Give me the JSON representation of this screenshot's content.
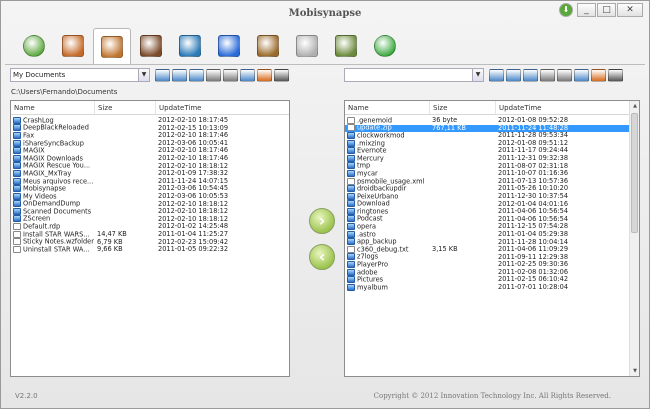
{
  "app": {
    "title": "Mobisynapse",
    "version": "V2.2.0",
    "copyright": "Copyright © 2012 Innovation Technology Inc. All Rights Reserved."
  },
  "window": {
    "update_icon": "update-icon",
    "minimize": "_",
    "maximize": "□",
    "close": "✕"
  },
  "tabs": [
    {
      "name": "home-icon",
      "color": "#5aa83c"
    },
    {
      "name": "device-icon",
      "color": "#c46a2a"
    },
    {
      "name": "file-manager-icon",
      "color": "#c0742e"
    },
    {
      "name": "photo-icon",
      "color": "#7a4a2a"
    },
    {
      "name": "video-icon",
      "color": "#2a7ab8"
    },
    {
      "name": "music-icon",
      "color": "#2a6ad8"
    },
    {
      "name": "contacts-icon",
      "color": "#9a6a2a"
    },
    {
      "name": "messages-icon",
      "color": "#b0b0b0"
    },
    {
      "name": "notes-icon",
      "color": "#6a8a3a"
    },
    {
      "name": "sync-icon",
      "color": "#3aa83c"
    }
  ],
  "left": {
    "location": "My Documents",
    "path": "C:\\Users\\Fernando\\Documents",
    "columns": [
      "Name",
      "Size",
      "UpdateTime"
    ],
    "rows": [
      {
        "name": "CrashLog",
        "size": "",
        "time": "2012-02-10 18:17:45",
        "type": "folder"
      },
      {
        "name": "DeepBlackReloaded",
        "size": "",
        "time": "2012-02-15 10:13:09",
        "type": "folder"
      },
      {
        "name": "Fax",
        "size": "",
        "time": "2012-02-10 18:17:46",
        "type": "folder"
      },
      {
        "name": "iShareSyncBackup",
        "size": "",
        "time": "2012-03-06 10:05:41",
        "type": "folder"
      },
      {
        "name": "MAGIX",
        "size": "",
        "time": "2012-02-10 18:17:46",
        "type": "folder"
      },
      {
        "name": "MAGIX Downloads",
        "size": "",
        "time": "2012-02-10 18:17:46",
        "type": "folder"
      },
      {
        "name": "MAGIX Rescue You...",
        "size": "",
        "time": "2012-02-10 18:18:12",
        "type": "folder"
      },
      {
        "name": "MAGIX_MxTray",
        "size": "",
        "time": "2012-01-09 17:38:32",
        "type": "folder"
      },
      {
        "name": "Meus arquivos rece...",
        "size": "",
        "time": "2011-11-24 14:07:15",
        "type": "folder"
      },
      {
        "name": "Mobisynapse",
        "size": "",
        "time": "2012-03-06 10:54:45",
        "type": "folder"
      },
      {
        "name": "My Videos",
        "size": "",
        "time": "2012-03-06 10:05:53",
        "type": "folder"
      },
      {
        "name": "OnDemandDump",
        "size": "",
        "time": "2012-02-10 18:18:12",
        "type": "folder"
      },
      {
        "name": "Scanned Documents",
        "size": "",
        "time": "2012-02-10 18:18:12",
        "type": "folder"
      },
      {
        "name": "ZScreen",
        "size": "",
        "time": "2012-02-10 18:18:12",
        "type": "folder"
      },
      {
        "name": "Default.rdp",
        "size": "",
        "time": "2012-01-02 14:25:48",
        "type": "file"
      },
      {
        "name": "Install STAR WARS...",
        "size": "14,47 KB",
        "time": "2011-01-04 11:25:27",
        "type": "file"
      },
      {
        "name": "Sticky Notes.wzfolder",
        "size": "6,79 KB",
        "time": "2012-02-23 15:09:42",
        "type": "file"
      },
      {
        "name": "Uninstall STAR WA...",
        "size": "9,66 KB",
        "time": "2011-01-05 09:22:32",
        "type": "file"
      }
    ]
  },
  "right": {
    "location": "",
    "columns": [
      "Name",
      "Size",
      "UpdateTime"
    ],
    "rows": [
      {
        "name": ".genemoid",
        "size": "36 byte",
        "time": "2012-01-08 09:52:28",
        "type": "file"
      },
      {
        "name": "update.zip",
        "size": "767,11 KB",
        "time": "2011-11-24 11:48:28",
        "type": "file",
        "selected": true
      },
      {
        "name": "clockworkmod",
        "size": "",
        "time": "2011-11-28 09:53:34",
        "type": "folder"
      },
      {
        "name": ".mixzing",
        "size": "",
        "time": "2012-01-08 09:51:12",
        "type": "folder"
      },
      {
        "name": "Evernote",
        "size": "",
        "time": "2011-11-17 09:24:44",
        "type": "folder"
      },
      {
        "name": "Mercury",
        "size": "",
        "time": "2011-12-31 09:32:38",
        "type": "folder"
      },
      {
        "name": "tmp",
        "size": "",
        "time": "2011-08-07 02:31:18",
        "type": "folder"
      },
      {
        "name": "mycar",
        "size": "",
        "time": "2011-10-07 01:16:36",
        "type": "folder"
      },
      {
        "name": "psmobile_usage.xml",
        "size": "",
        "time": "2011-07-13 10:57:36",
        "type": "file"
      },
      {
        "name": "droidbackupdir",
        "size": "",
        "time": "2011-05-26 10:10:20",
        "type": "folder"
      },
      {
        "name": "PeixeUrbano",
        "size": "",
        "time": "2011-12-30 10:37:54",
        "type": "folder"
      },
      {
        "name": "Download",
        "size": "",
        "time": "2012-01-04 04:01:16",
        "type": "folder"
      },
      {
        "name": "ringtones",
        "size": "",
        "time": "2011-04-06 10:56:54",
        "type": "folder"
      },
      {
        "name": "Podcast",
        "size": "",
        "time": "2011-04-06 10:56:54",
        "type": "folder"
      },
      {
        "name": "opera",
        "size": "",
        "time": "2011-12-15 07:54:28",
        "type": "folder"
      },
      {
        "name": ".astro",
        "size": "",
        "time": "2011-01-04 05:29:38",
        "type": "folder"
      },
      {
        "name": "app_backup",
        "size": "",
        "time": "2011-11-28 10:04:14",
        "type": "folder"
      },
      {
        "name": "c360_debug.txt",
        "size": "3,15 KB",
        "time": "2011-04-06 11:09:29",
        "type": "file"
      },
      {
        "name": "z7logs",
        "size": "",
        "time": "2011-09-11 12:29:38",
        "type": "folder"
      },
      {
        "name": "PlayerPro",
        "size": "",
        "time": "2011-02-25 09:30:36",
        "type": "folder"
      },
      {
        "name": "adobe",
        "size": "",
        "time": "2011-02-08 01:32:06",
        "type": "folder"
      },
      {
        "name": "Pictures",
        "size": "",
        "time": "2011-02-15 06:10:42",
        "type": "folder"
      },
      {
        "name": "myalbum",
        "size": "",
        "time": "2011-07-01 10:28:04",
        "type": "folder"
      }
    ]
  },
  "transfer": {
    "to_right": "›",
    "to_left": "‹"
  },
  "toolbar_icons": [
    "drive-icon",
    "refresh-icon",
    "up-folder-icon",
    "back-icon",
    "forward-icon",
    "new-folder-icon",
    "rename-icon",
    "delete-icon"
  ]
}
